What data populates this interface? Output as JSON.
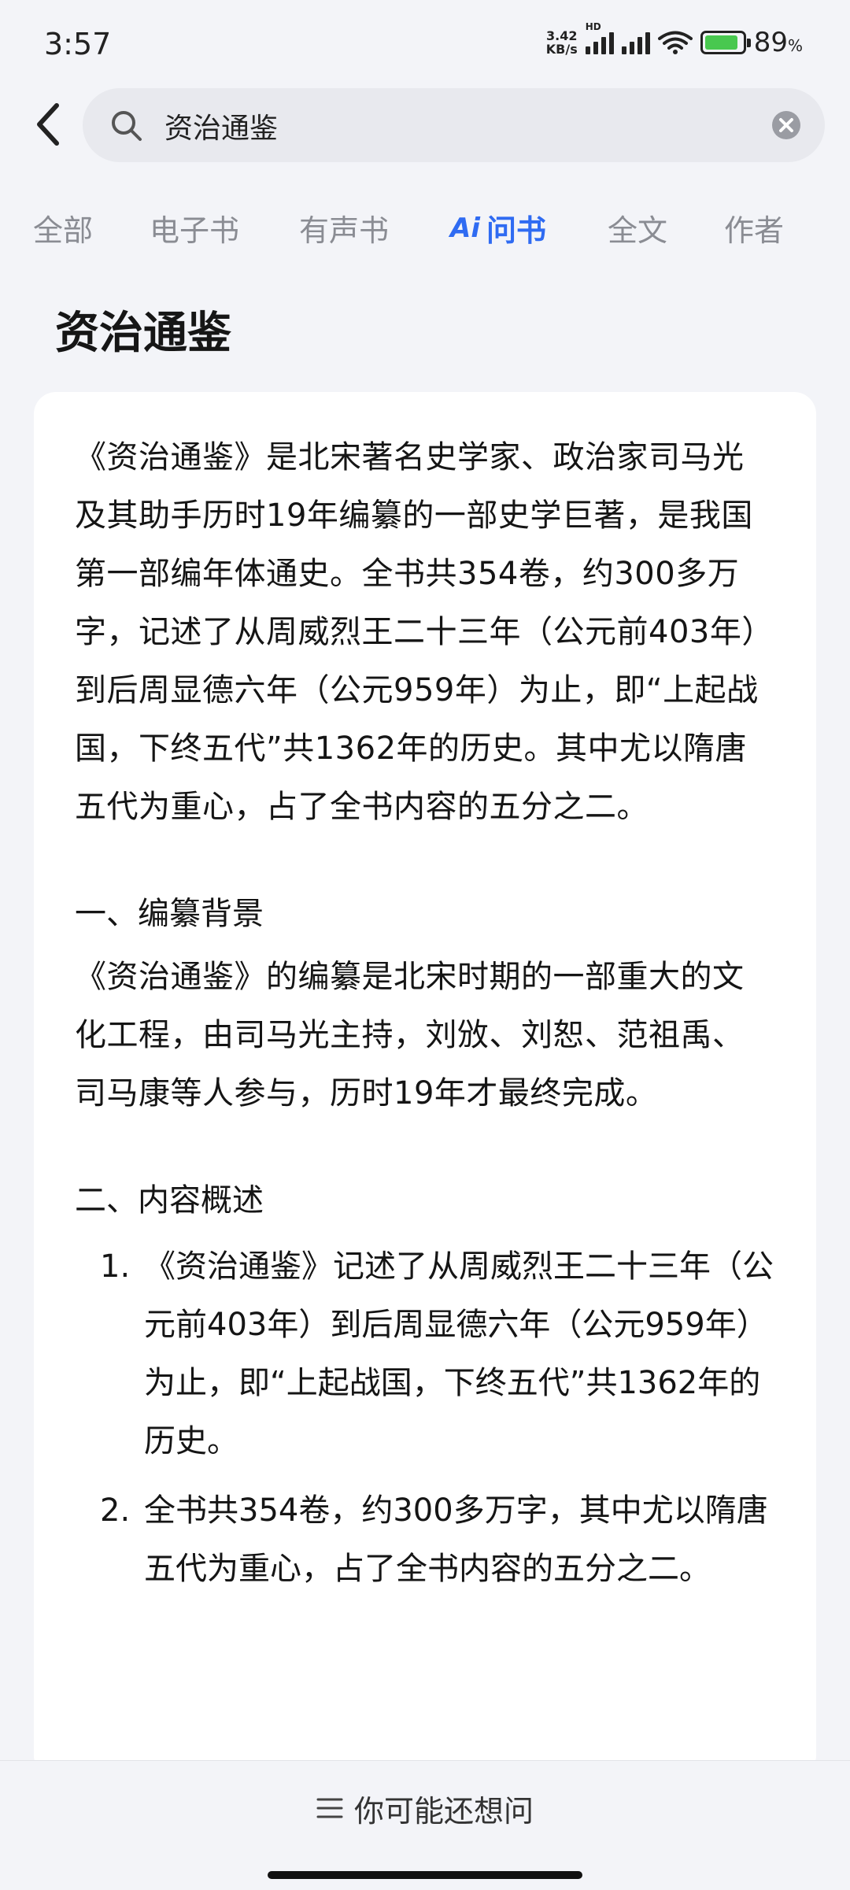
{
  "status_bar": {
    "time": "3:57",
    "net_speed_value": "3.42",
    "net_speed_unit": "KB/s",
    "hd_label": "HD",
    "battery_percent": "89",
    "battery_percent_symbol": "%",
    "battery_level": 0.89,
    "battery_color": "#49c84f"
  },
  "search": {
    "query": "资治通鉴"
  },
  "tabs": [
    {
      "label": "全部"
    },
    {
      "label": "电子书"
    },
    {
      "label": "有声书"
    },
    {
      "label": "问书",
      "prefix": "Ai",
      "active": true
    },
    {
      "label": "全文"
    },
    {
      "label": "作者"
    }
  ],
  "accent_color": "#2f6bf2",
  "page_title": "资治通鉴",
  "content": {
    "intro": "《资治通鉴》是北宋著名史学家、政治家司马光及其助手历时19年编纂的一部史学巨著，是我国第一部编年体通史。全书共354卷，约300多万字，记述了从周威烈王二十三年（公元前403年）到后周显德六年（公元959年）为止，即“上起战国，下终五代”共1362年的历史。其中尤以隋唐五代为重心，占了全书内容的五分之二。",
    "section1_title": "一、编纂背景",
    "section1_text": "《资治通鉴》的编纂是北宋时期的一部重大的文化工程，由司马光主持，刘攽、刘恕、范祖禹、司马康等人参与，历时19年才最终完成。",
    "section2_title": "二、内容概述",
    "section2_items": [
      {
        "num": "1.",
        "text": "《资治通鉴》记述了从周威烈王二十三年（公元前403年）到后周显德六年（公元959年）为止，即“上起战国，下终五代”共1362年的历史。"
      },
      {
        "num": "2.",
        "text": "全书共354卷，约300多万字，其中尤以隋唐五代为重心，占了全书内容的五分之二。"
      }
    ]
  },
  "bottom": {
    "suggest_label": "你可能还想问"
  }
}
